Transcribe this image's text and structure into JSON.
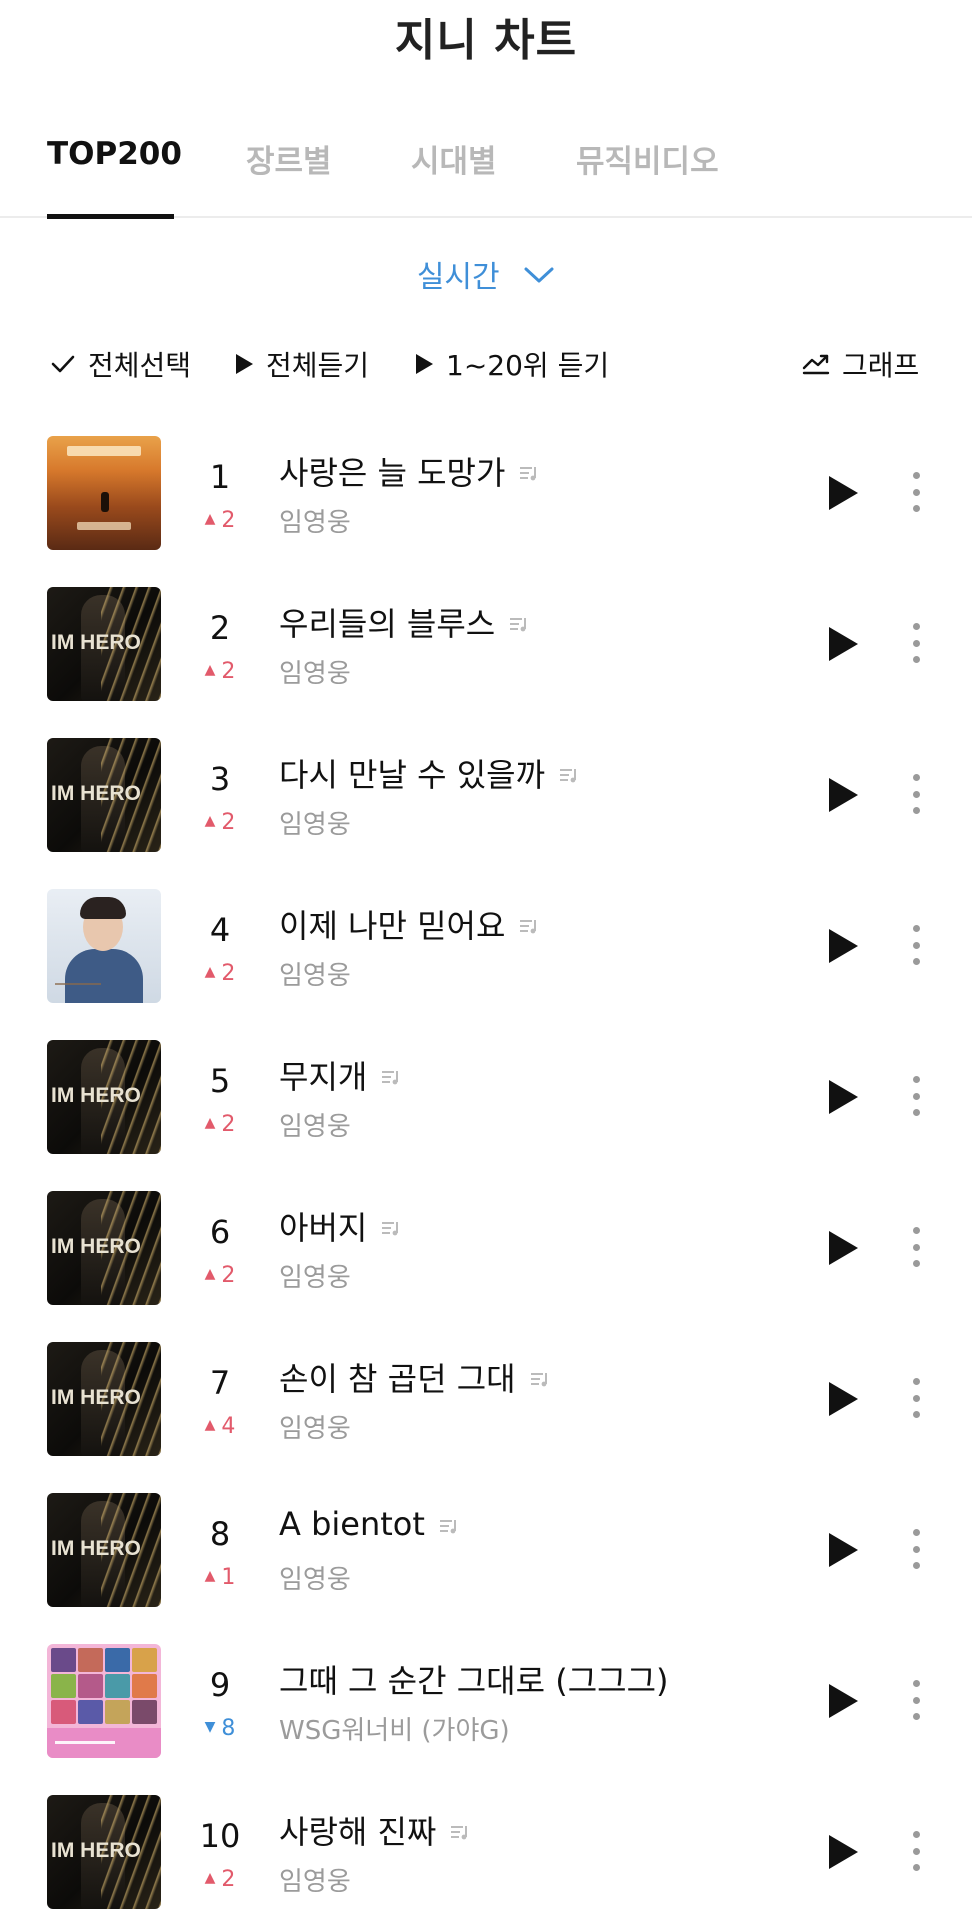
{
  "header": {
    "title": "지니 차트"
  },
  "tabs": [
    {
      "label": "TOP200",
      "active": true
    },
    {
      "label": "장르별",
      "active": false
    },
    {
      "label": "시대별",
      "active": false
    },
    {
      "label": "뮤직비디오",
      "active": false
    }
  ],
  "period": {
    "label": "실시간",
    "icon": "chevron-down-icon"
  },
  "toolbar": {
    "select_all": "전체선택",
    "play_all": "전체듣기",
    "play_top20": "1~20위 듣기",
    "graph": "그래프"
  },
  "colors": {
    "accent_blue": "#3f8fd8",
    "rank_up": "#e25a6b",
    "rank_down": "#3f8fd8",
    "tab_inactive": "#b8b8b8"
  },
  "songs": [
    {
      "rank": "1",
      "change": "2",
      "direction": "up",
      "title": "사랑은 늘 도망가",
      "artist": "임영웅",
      "lyrics_icon": true
    },
    {
      "rank": "2",
      "change": "2",
      "direction": "up",
      "title": "우리들의 블루스",
      "artist": "임영웅",
      "lyrics_icon": true
    },
    {
      "rank": "3",
      "change": "2",
      "direction": "up",
      "title": "다시 만날 수 있을까",
      "artist": "임영웅",
      "lyrics_icon": true
    },
    {
      "rank": "4",
      "change": "2",
      "direction": "up",
      "title": "이제 나만 믿어요",
      "artist": "임영웅",
      "lyrics_icon": true
    },
    {
      "rank": "5",
      "change": "2",
      "direction": "up",
      "title": "무지개",
      "artist": "임영웅",
      "lyrics_icon": true
    },
    {
      "rank": "6",
      "change": "2",
      "direction": "up",
      "title": "아버지",
      "artist": "임영웅",
      "lyrics_icon": true
    },
    {
      "rank": "7",
      "change": "4",
      "direction": "up",
      "title": "손이 참 곱던 그대",
      "artist": "임영웅",
      "lyrics_icon": true
    },
    {
      "rank": "8",
      "change": "1",
      "direction": "up",
      "title": "A bientot",
      "artist": "임영웅",
      "lyrics_icon": true
    },
    {
      "rank": "9",
      "change": "8",
      "direction": "down",
      "title": "그때 그 순간 그대로 (그그그)",
      "artist": "WSG워너비 (가야G)",
      "lyrics_icon": false
    },
    {
      "rank": "10",
      "change": "2",
      "direction": "up",
      "title": "사랑해 진짜",
      "artist": "임영웅",
      "lyrics_icon": true
    }
  ],
  "album_art_text": "IM HERO"
}
